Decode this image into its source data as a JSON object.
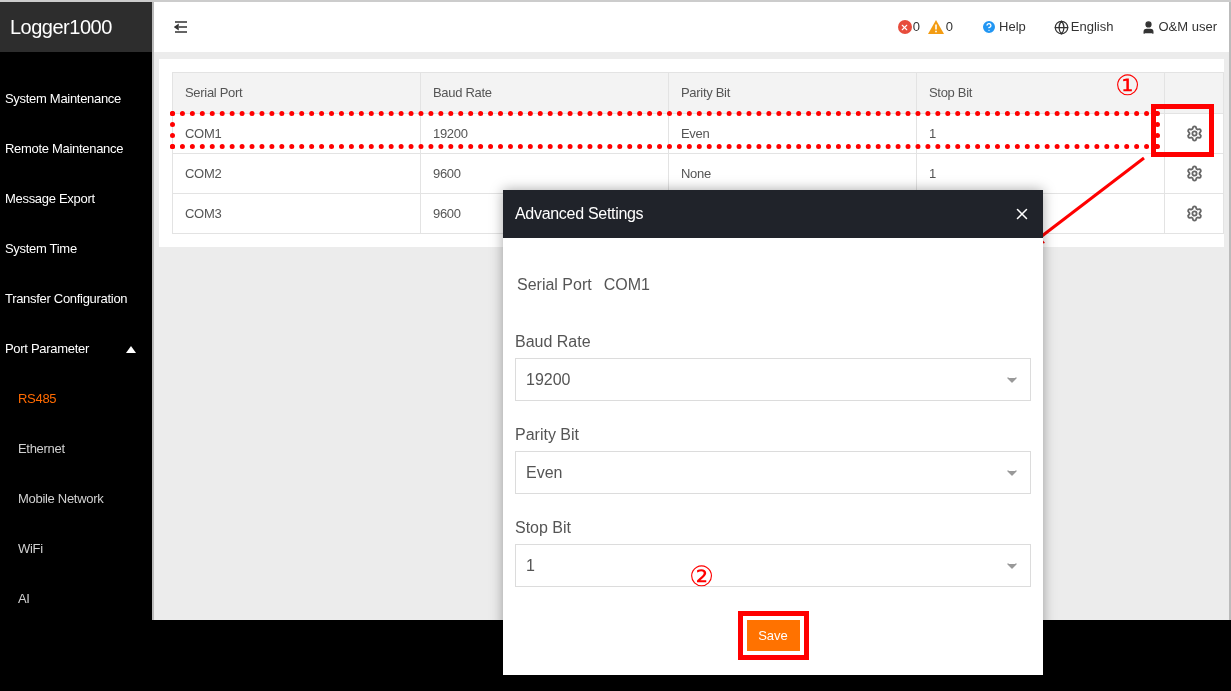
{
  "brand": "Logger1000",
  "header": {
    "alarm_count": "0",
    "warning_count": "0",
    "help": "Help",
    "language": "English",
    "user": "O&M user"
  },
  "sidebar": {
    "items": [
      {
        "label": "System Maintenance",
        "selected": false
      },
      {
        "label": "Remote Maintenance",
        "selected": false
      },
      {
        "label": "Message Export",
        "selected": false
      },
      {
        "label": "System Time",
        "selected": false
      },
      {
        "label": "Transfer Configuration",
        "selected": false
      },
      {
        "label": "Port Parameter",
        "selected": false,
        "expanded": true,
        "children": [
          {
            "label": "RS485",
            "selected": true
          },
          {
            "label": "Ethernet",
            "selected": false
          },
          {
            "label": "Mobile Network",
            "selected": false
          },
          {
            "label": "WiFi",
            "selected": false
          },
          {
            "label": "AI",
            "selected": false
          }
        ]
      }
    ]
  },
  "table": {
    "columns": [
      "Serial Port",
      "Baud Rate",
      "Parity Bit",
      "Stop Bit"
    ],
    "rows": [
      [
        "COM1",
        "19200",
        "Even",
        "1"
      ],
      [
        "COM2",
        "9600",
        "None",
        "1"
      ],
      [
        "COM3",
        "9600",
        "",
        ""
      ]
    ]
  },
  "dialog": {
    "title": "Advanced Settings",
    "serial_port_label": "Serial Port",
    "serial_port": "COM1",
    "fields": [
      {
        "label": "Baud Rate",
        "value": "19200"
      },
      {
        "label": "Parity Bit",
        "value": "Even"
      },
      {
        "label": "Stop Bit",
        "value": "1"
      }
    ],
    "save": "Save"
  },
  "annotations": [
    "①",
    "②"
  ]
}
